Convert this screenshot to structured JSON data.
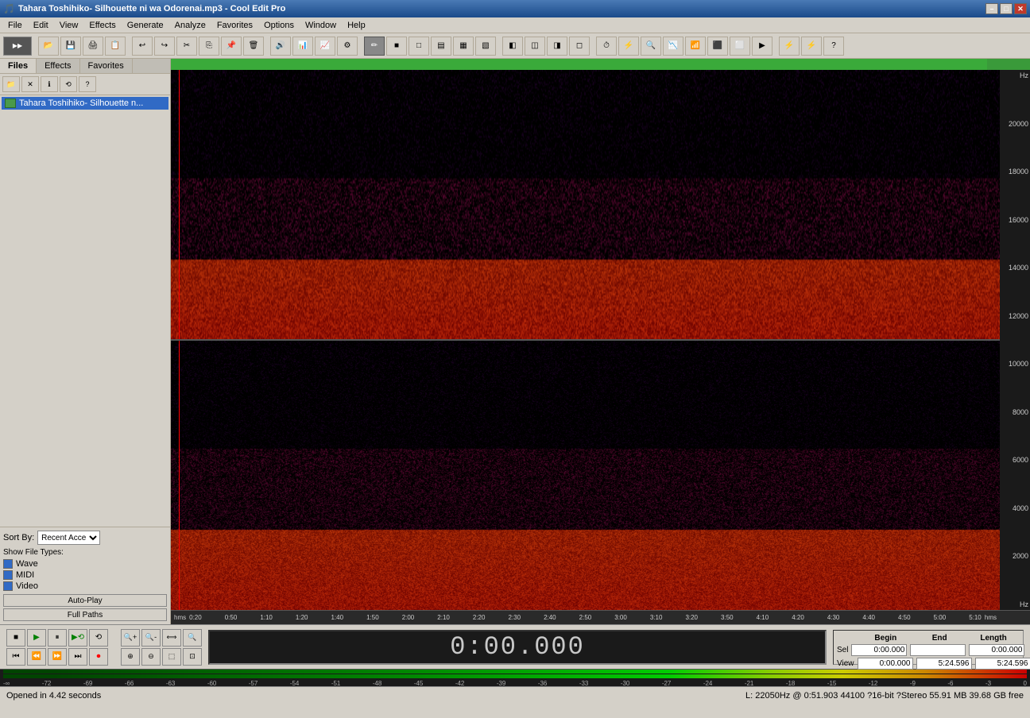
{
  "titlebar": {
    "title": "Tahara Toshihiko- Silhouette ni wa Odorenai.mp3 - Cool Edit Pro",
    "min": "–",
    "max": "□",
    "close": "✕"
  },
  "menu": {
    "items": [
      "File",
      "Edit",
      "View",
      "Effects",
      "Generate",
      "Analyze",
      "Favorites",
      "Options",
      "Window",
      "Help"
    ]
  },
  "panel": {
    "tabs": [
      "Files",
      "Effects",
      "Favorites"
    ],
    "active_tab": "Files",
    "file_name": "Tahara Toshihiko- Silhouette n...",
    "show_file_types_label": "Show File Types:",
    "file_types": [
      "Wave",
      "MIDI",
      "Video"
    ],
    "sort_by_label": "Sort By:",
    "sort_value": "Recent Acce",
    "btn_auto_play": "Auto-Play",
    "btn_full_paths": "Full Paths"
  },
  "hz_labels": [
    "Hz",
    "20000",
    "18000",
    "16000",
    "14000",
    "12000",
    "10000",
    "8000",
    "6000",
    "4000",
    "2000",
    "Hz"
  ],
  "time_ruler": {
    "labels": [
      "hms",
      "0:20",
      "0:50",
      "1:10",
      "1:20",
      "1:40",
      "1:50",
      "2:00",
      "2:10",
      "2:20",
      "2:30",
      "2:40",
      "2:50",
      "3:00",
      "3:10",
      "3:20",
      "3:50",
      "4:10",
      "4:20",
      "4:30",
      "4:40",
      "4:50",
      "5:00",
      "5:10",
      "hms"
    ]
  },
  "transport": {
    "time": "0:00.000",
    "buttons_row1": [
      "■",
      "▶",
      "⏸",
      "⏵",
      "⟲"
    ],
    "buttons_row2": [
      "⏮",
      "⏪",
      "⏩",
      "⏭",
      "⏺"
    ]
  },
  "zoom": {
    "buttons_row1": [
      "🔍+",
      "🔍-",
      "⟺",
      "🔍"
    ],
    "buttons_row2": [
      "🔍+",
      "🔍-",
      "⟺",
      "🔍"
    ]
  },
  "selection": {
    "begin_label": "Begin",
    "end_label": "End",
    "length_label": "Length",
    "sel_label": "Sel",
    "view_label": "View",
    "sel_begin": "0:00.000",
    "sel_end": "",
    "sel_length": "0:00.000",
    "view_begin": "0:00.000",
    "view_end": "5:24.596",
    "view_length": "5:24.596"
  },
  "level_labels": [
    "-∞",
    "-72",
    "-69",
    "-66",
    "-63",
    "-60",
    "-57",
    "-54",
    "-51",
    "-48",
    "-45",
    "-42",
    "-39",
    "-36",
    "-33",
    "-30",
    "-27",
    "-24",
    "-21",
    "-18",
    "-15",
    "-12",
    "-9",
    "-6",
    "-3",
    "0"
  ],
  "status": {
    "left": "Opened in 4.42 seconds",
    "right": "L: 22050Hz @  0:51.903    44100 ?16-bit ?Stereo    55.91 MB    39.68 GB free"
  }
}
